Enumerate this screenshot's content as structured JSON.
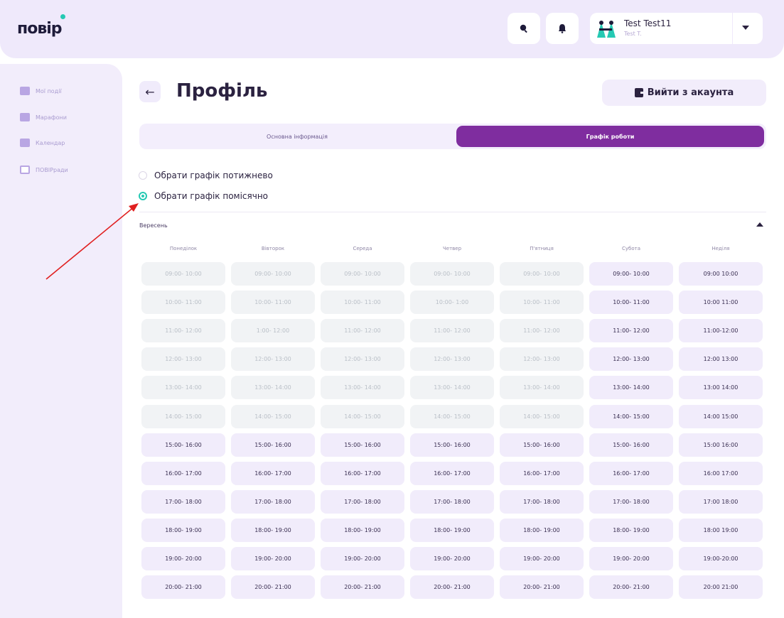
{
  "header": {
    "logo_text": "повір",
    "search_icon": "search-icon",
    "bell_icon": "bell-icon",
    "user_name": "Test Test11",
    "user_sub": "Test T."
  },
  "sidebar": {
    "items": [
      {
        "label": "Мої події",
        "icon": "home-icon"
      },
      {
        "label": "Марафони",
        "icon": "trophy-icon"
      },
      {
        "label": "Календар",
        "icon": "calendar-icon"
      },
      {
        "label": "ПОВІРради",
        "icon": "board-icon"
      }
    ]
  },
  "main": {
    "title": "Профіль",
    "logout_label": "Вийти з акаунта",
    "tabs": [
      {
        "label": "Основна інформація",
        "active": false
      },
      {
        "label": "Графік роботи",
        "active": true
      }
    ],
    "radio_weekly": "Обрати графік потижнево",
    "radio_monthly": "Обрати графік помісячно",
    "selected_mode": "monthly",
    "month": "Вересень"
  },
  "schedule": {
    "days": [
      "Понеділок",
      "Вівторок",
      "Середа",
      "Четвер",
      "П'ятниця",
      "Субота",
      "Неділя"
    ],
    "rows": [
      {
        "slots": [
          "09:00- 10:00",
          "09:00- 10:00",
          "09:00- 10:00",
          "09:00- 10:00",
          "09:00- 10:00",
          "09:00- 10:00",
          "09:00 10:00"
        ],
        "disabled_until": 5
      },
      {
        "slots": [
          "10:00- 11:00",
          "10:00- 11:00",
          "10:00- 11:00",
          "10:00- 1:00",
          "10:00- 11:00",
          "10:00- 11:00",
          "10:00 11:00"
        ],
        "disabled_until": 5
      },
      {
        "slots": [
          "11:00- 12:00",
          "1:00- 12:00",
          "11:00- 12:00",
          "11:00- 12:00",
          "11:00- 12:00",
          "11:00- 12:00",
          "11:00-12:00"
        ],
        "disabled_until": 5
      },
      {
        "slots": [
          "12:00- 13:00",
          "12:00- 13:00",
          "12:00- 13:00",
          "12:00- 13:00",
          "12:00- 13:00",
          "12:00- 13:00",
          "12:00 13:00"
        ],
        "disabled_until": 5
      },
      {
        "slots": [
          "13:00- 14:00",
          "13:00- 14:00",
          "13:00- 14:00",
          "13:00- 14:00",
          "13:00- 14:00",
          "13:00- 14:00",
          "13:00 14:00"
        ],
        "disabled_until": 5
      },
      {
        "slots": [
          "14:00- 15:00",
          "14:00- 15:00",
          "14:00- 15:00",
          "14:00- 15:00",
          "14:00- 15:00",
          "14:00- 15:00",
          "14:00 15:00"
        ],
        "disabled_until": 5
      },
      {
        "slots": [
          "15:00- 16:00",
          "15:00- 16:00",
          "15:00- 16:00",
          "15:00- 16:00",
          "15:00- 16:00",
          "15:00- 16:00",
          "15:00 16:00"
        ],
        "disabled_until": 0
      },
      {
        "slots": [
          "16:00- 17:00",
          "16:00- 17:00",
          "16:00- 17:00",
          "16:00- 17:00",
          "16:00- 17:00",
          "16:00- 17:00",
          "16:00 17:00"
        ],
        "disabled_until": 0
      },
      {
        "slots": [
          "17:00- 18:00",
          "17:00- 18:00",
          "17:00- 18:00",
          "17:00- 18:00",
          "17:00- 18:00",
          "17:00- 18:00",
          "17:00 18:00"
        ],
        "disabled_until": 0
      },
      {
        "slots": [
          "18:00- 19:00",
          "18:00- 19:00",
          "18:00- 19:00",
          "18:00- 19:00",
          "18:00- 19:00",
          "18:00- 19:00",
          "18:00 19:00"
        ],
        "disabled_until": 0
      },
      {
        "slots": [
          "19:00- 20:00",
          "19:00- 20:00",
          "19:00- 20:00",
          "19:00- 20:00",
          "19:00- 20:00",
          "19:00- 20:00",
          "19:00-20:00"
        ],
        "disabled_until": 0
      },
      {
        "slots": [
          "20:00- 21:00",
          "20:00- 21:00",
          "20:00- 21:00",
          "20:00- 21:00",
          "20:00- 21:00",
          "20:00- 21:00",
          "20:00 21:00"
        ],
        "disabled_until": 0
      }
    ]
  },
  "colors": {
    "accent": "#7f2d9f",
    "radio_on": "#25c9b3",
    "annotation_arrow": "#e02020"
  }
}
